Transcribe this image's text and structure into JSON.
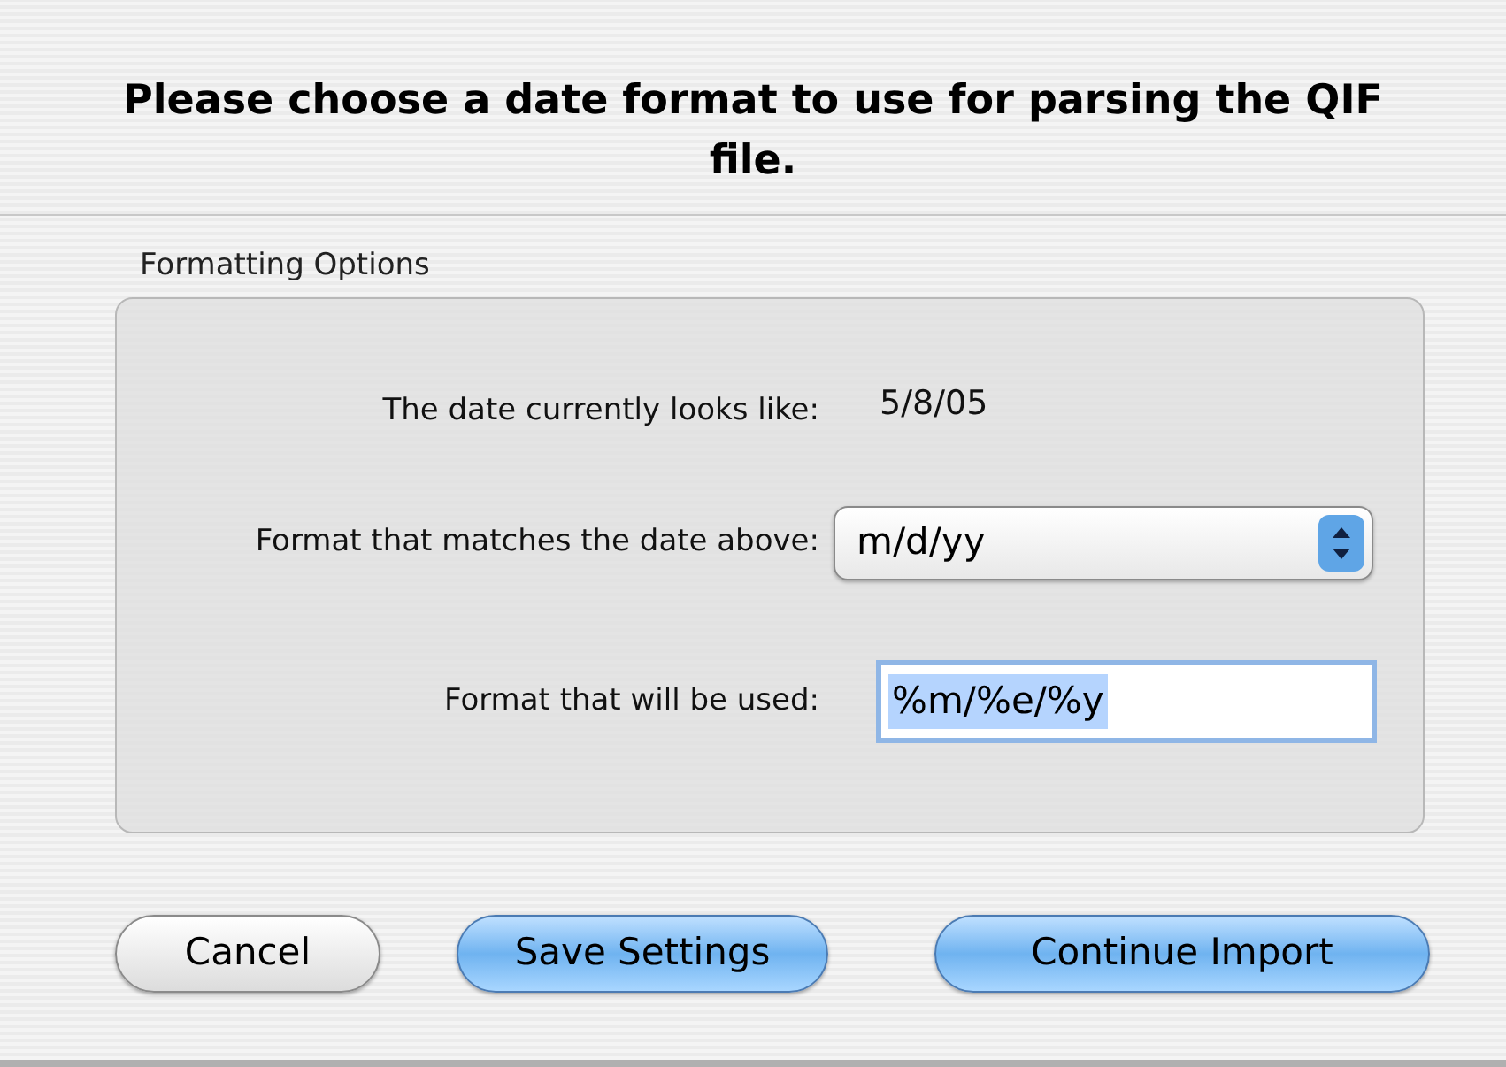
{
  "title": "Please choose a date format to use for parsing the QIF file.",
  "group": {
    "label": "Formatting Options",
    "rows": [
      {
        "kind": "value",
        "label": "The date currently looks like:",
        "value": "5/8/05"
      },
      {
        "kind": "popup",
        "label": "Format that matches the date above:",
        "value": "m/d/yy"
      },
      {
        "kind": "field",
        "label": "Format that will be used:",
        "value": "%m/%e/%y",
        "text_selected": true
      }
    ]
  },
  "buttons": [
    {
      "label": "Cancel",
      "emphasized": false
    },
    {
      "label": "Save Settings",
      "emphasized": true
    },
    {
      "label": "Continue Import",
      "emphasized": true
    }
  ]
}
